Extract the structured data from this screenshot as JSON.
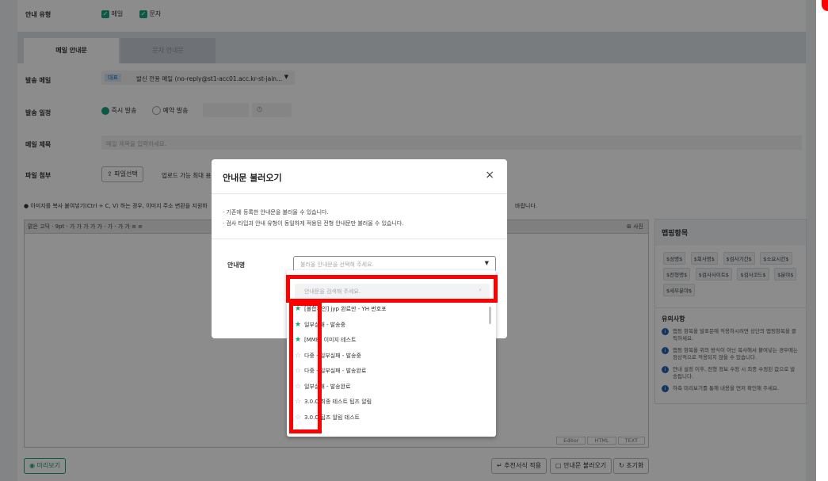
{
  "form": {
    "notice_type_label": "안내 유형",
    "notice_type_email": "메일",
    "notice_type_sms": "문자",
    "tab_email": "메일 안내문",
    "tab_sms": "문자 안내문",
    "sender_label": "발송 메일",
    "sender_badge": "대표",
    "sender_value": "발신 전용 메일 (no-reply@st1-acc01.acc.kr-st-jain...",
    "schedule_label": "발송 일정",
    "schedule_now": "즉시 발송",
    "schedule_reserve": "예약 발송",
    "subject_label": "메일 제목",
    "subject_placeholder": "메일 제목을 입력하세요.",
    "attach_label": "파일 첨부",
    "attach_button": "파일선택",
    "attach_hint": "업로드 가능 최대 용량 : 1",
    "image_notice": "● 이미지를 복사 붙여넣기(Ctrl + C, V) 하는 경우, 이미지 주소 변환을 지원하",
    "image_notice_tail": "바랍니다.",
    "editor_tools": "맑은 고딕 · 9pt · 가 가 가 가 가 · 가 · 가 가 ≡ ≡",
    "editor_side_btn": "⊞ 사진",
    "editor_modes": [
      "Editor",
      "HTML",
      "TEXT"
    ]
  },
  "sidebar": {
    "mapping_title": "맵핑항목",
    "chips": [
      "$성명$",
      "$회사명$",
      "$검사기간$",
      "$소요시간$",
      "$전형명$",
      "$검사사이트$",
      "$검사코드$",
      "$분야$",
      "$세부분야$"
    ],
    "notes_title": "유의사항",
    "notes": [
      "맵핑 항목을 발표문에 적용하시려면 상단의 맵핑항목을 클릭하세요.",
      "맵핑 항목을 위의 방식이 아닌 복사해서 붙여넣는 경우에는 정상적으로 적용되지 않을 수 있습니다.",
      "안내 설정 이후, 전형 정보 수정 시 최종 수정된 값으로 발송됩니다.",
      "하측 미리보기를 통해 내용을 먼저 확인해 주세요."
    ]
  },
  "bottom": {
    "preview": "미리보기",
    "recommend": "추천서식 적용",
    "load": "안내문 불러오기",
    "reset": "초기화"
  },
  "modal": {
    "title": "안내문 불러오기",
    "desc1": "· 기존에 등록한 안내문을 불러올 수 있습니다.",
    "desc2": "· 검사 타입과 안내 유형이 동일하게 적용된 전형 안내문만 불러올 수 있습니다.",
    "field_label": "안내명",
    "select_placeholder": "불러올 안내문을 선택해 주세요.",
    "search_placeholder": "안내문을 검색해 주세요."
  },
  "dropdown_items": [
    {
      "label": "[불합확인] jyp 완료만 - YH 번호포",
      "fav": true
    },
    {
      "label": "일부실패 - 발송중",
      "fav": true
    },
    {
      "label": "[MMB] 이미지 테스트",
      "fav": true
    },
    {
      "label": "다중 - 일부실패 - 발송중",
      "fav": false
    },
    {
      "label": "다중 - 일부실패 - 발송완료",
      "fav": false
    },
    {
      "label": "일부실패 - 발송완료",
      "fav": false
    },
    {
      "label": "3.0.C 최종 테스트 팁즈 알림",
      "fav": false
    },
    {
      "label": "3.0.C 팁즈 알림 테스트",
      "fav": false
    }
  ],
  "colors": {
    "accent": "#19a37c",
    "highlight": "#ff0000",
    "fav_star": "#19a37c"
  }
}
